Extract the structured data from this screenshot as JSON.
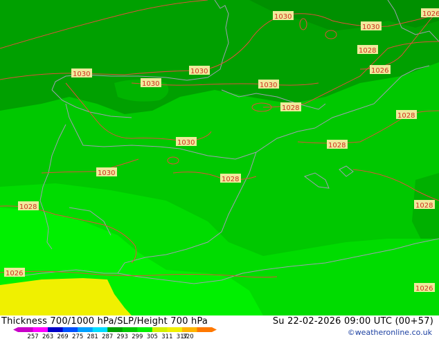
{
  "title": "Thickness 700/1000 hPa/SLP/Height 700 hPa",
  "valid_time": "Su 22-02-2026 09:00 UTC (00+57)",
  "credit": "©weatheronline.co.uk",
  "colors": {
    "dark_green": "#00a000",
    "mid_green": "#00b400",
    "green": "#00c800",
    "bright_green": "#00dc00",
    "lime": "#00f000",
    "yellow": "#f0f000",
    "isobar": "#e0503c",
    "coast": "#a0a0b4"
  },
  "isobar_labels": [
    {
      "text": "1030"
    },
    {
      "text": "1030"
    },
    {
      "text": "1030"
    },
    {
      "text": "1030"
    },
    {
      "text": "1030"
    },
    {
      "text": "1030"
    },
    {
      "text": "1030"
    },
    {
      "text": "1030"
    },
    {
      "text": "1028"
    },
    {
      "text": "1028"
    },
    {
      "text": "1028"
    },
    {
      "text": "1028"
    },
    {
      "text": "1028"
    },
    {
      "text": "1028"
    },
    {
      "text": "1028"
    },
    {
      "text": "1026"
    },
    {
      "text": "1026"
    },
    {
      "text": "1026"
    },
    {
      "text": "1026"
    }
  ],
  "scale": {
    "ticks": [
      "257",
      "263",
      "269",
      "275",
      "281",
      "287",
      "293",
      "299",
      "305",
      "311",
      "317",
      "320"
    ],
    "colors": [
      "#c800c8",
      "#ff00ff",
      "#0000c8",
      "#0050ff",
      "#00a0ff",
      "#00dcff",
      "#00a000",
      "#00c800",
      "#00f000",
      "#d2f000",
      "#f0f000",
      "#ffb400",
      "#ff7800"
    ]
  }
}
